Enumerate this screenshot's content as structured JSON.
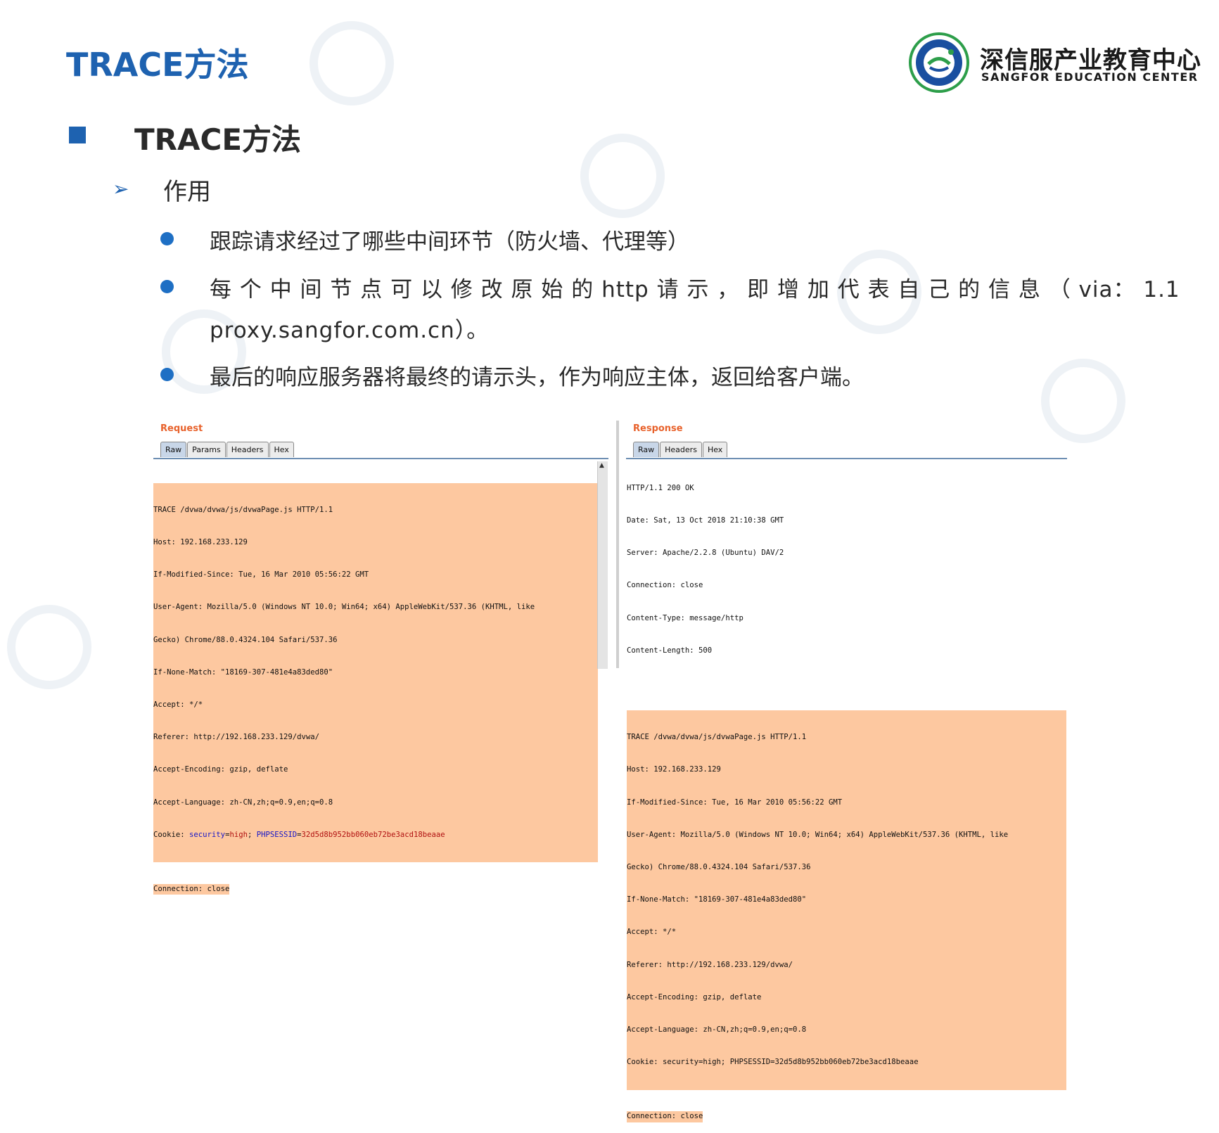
{
  "header": {
    "title": "TRACE方法",
    "logo_cn": "深信服产业教育中心",
    "logo_en": "SANGFOR EDUCATION CENTER"
  },
  "section": {
    "heading": "TRACE方法",
    "subheading": "作用",
    "bullets": [
      "跟踪请求经过了哪些中间环节（防火墙、代理等）",
      "每 个 中 间 节 点 可 以 修 改 原 始 的 http 请 示 ， 即 增 加 代 表 自 己 的 信 息 （ via：  1.1",
      "proxy.sangfor.com.cn）。",
      "最后的响应服务器将最终的请示头，作为响应主体，返回给客户端。"
    ]
  },
  "request_panel": {
    "title": "Request",
    "tabs": [
      "Raw",
      "Params",
      "Headers",
      "Hex"
    ],
    "active_tab": "Raw",
    "lines": [
      "TRACE /dvwa/dvwa/js/dvwaPage.js HTTP/1.1",
      "Host: 192.168.233.129",
      "If-Modified-Since: Tue, 16 Mar 2010 05:56:22 GMT",
      "User-Agent: Mozilla/5.0 (Windows NT 10.0; Win64; x64) AppleWebKit/537.36 (KHTML, like",
      "Gecko) Chrome/88.0.4324.104 Safari/537.36",
      "If-None-Match: \"18169-307-481e4a83ded80\"",
      "Accept: */*",
      "Referer: http://192.168.233.129/dvwa/",
      "Accept-Encoding: gzip, deflate",
      "Accept-Language: zh-CN,zh;q=0.9,en;q=0.8"
    ],
    "cookie_prefix": "Cookie: ",
    "cookie_key1": "security",
    "cookie_val1": "high",
    "cookie_sep": "; ",
    "cookie_key2": "PHPSESSID",
    "cookie_val2": "32d5d8b952bb060eb72be3acd18beaae",
    "last_line": "Connection: close"
  },
  "response_panel": {
    "title": "Response",
    "tabs": [
      "Raw",
      "Headers",
      "Hex"
    ],
    "active_tab": "Raw",
    "header_lines": [
      "HTTP/1.1 200 OK",
      "Date: Sat, 13 Oct 2018 21:10:38 GMT",
      "Server: Apache/2.2.8 (Ubuntu) DAV/2",
      "Connection: close",
      "Content-Type: message/http",
      "Content-Length: 500"
    ],
    "body_lines": [
      "TRACE /dvwa/dvwa/js/dvwaPage.js HTTP/1.1",
      "Host: 192.168.233.129",
      "If-Modified-Since: Tue, 16 Mar 2010 05:56:22 GMT",
      "User-Agent: Mozilla/5.0 (Windows NT 10.0; Win64; x64) AppleWebKit/537.36 (KHTML, like",
      "Gecko) Chrome/88.0.4324.104 Safari/537.36",
      "If-None-Match: \"18169-307-481e4a83ded80\"",
      "Accept: */*",
      "Referer: http://192.168.233.129/dvwa/",
      "Accept-Encoding: gzip, deflate",
      "Accept-Language: zh-CN,zh;q=0.9,en;q=0.8",
      "Cookie: security=high; PHPSESSID=32d5d8b952bb060eb72be3acd18beaae",
      "Connection: close"
    ]
  },
  "colors": {
    "accent": "#1e62b0",
    "highlight": "#fdc8a0",
    "panel_title": "#e8622c"
  }
}
